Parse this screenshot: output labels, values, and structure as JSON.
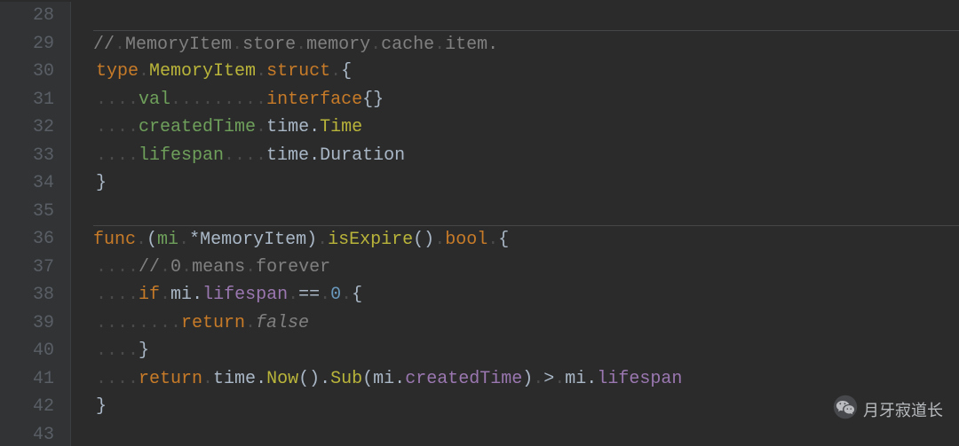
{
  "watermark": "月牙寂道长",
  "line_numbers": [
    "28",
    "29",
    "30",
    "31",
    "32",
    "33",
    "34",
    "35",
    "36",
    "37",
    "38",
    "39",
    "40",
    "41",
    "42",
    "43"
  ],
  "code": [
    {
      "n": 28,
      "sep": false,
      "tokens": []
    },
    {
      "n": 29,
      "sep": true,
      "tokens": [
        {
          "t": "//",
          "c": "comment"
        },
        {
          "t": ".",
          "c": "ws"
        },
        {
          "t": "MemoryItem",
          "c": "comment"
        },
        {
          "t": ".",
          "c": "ws"
        },
        {
          "t": "store",
          "c": "comment"
        },
        {
          "t": ".",
          "c": "ws"
        },
        {
          "t": "memory",
          "c": "comment"
        },
        {
          "t": ".",
          "c": "ws"
        },
        {
          "t": "cache",
          "c": "comment"
        },
        {
          "t": ".",
          "c": "ws"
        },
        {
          "t": "item.",
          "c": "comment"
        }
      ]
    },
    {
      "n": 30,
      "sep": false,
      "tokens": [
        {
          "t": "type",
          "c": "kw"
        },
        {
          "t": ".",
          "c": "ws"
        },
        {
          "t": "MemoryItem",
          "c": "typename"
        },
        {
          "t": ".",
          "c": "ws"
        },
        {
          "t": "struct",
          "c": "kw"
        },
        {
          "t": ".",
          "c": "ws"
        },
        {
          "t": "{",
          "c": "punc"
        }
      ]
    },
    {
      "n": 31,
      "sep": false,
      "tokens": [
        {
          "t": "....",
          "c": "ws"
        },
        {
          "t": "val",
          "c": "field"
        },
        {
          "t": ".........",
          "c": "ws"
        },
        {
          "t": "interface",
          "c": "kw"
        },
        {
          "t": "{}",
          "c": "punc"
        }
      ]
    },
    {
      "n": 32,
      "sep": false,
      "tokens": [
        {
          "t": "....",
          "c": "ws"
        },
        {
          "t": "createdTime",
          "c": "field"
        },
        {
          "t": ".",
          "c": "ws"
        },
        {
          "t": "time",
          "c": "pkg"
        },
        {
          "t": ".",
          "c": "punc"
        },
        {
          "t": "Time",
          "c": "typ"
        }
      ]
    },
    {
      "n": 33,
      "sep": false,
      "tokens": [
        {
          "t": "....",
          "c": "ws"
        },
        {
          "t": "lifespan",
          "c": "field"
        },
        {
          "t": "....",
          "c": "ws"
        },
        {
          "t": "time",
          "c": "pkg"
        },
        {
          "t": ".",
          "c": "punc"
        },
        {
          "t": "Duration",
          "c": "pkg"
        }
      ]
    },
    {
      "n": 34,
      "sep": false,
      "tokens": [
        {
          "t": "}",
          "c": "punc"
        }
      ]
    },
    {
      "n": 35,
      "sep": false,
      "tokens": []
    },
    {
      "n": 36,
      "sep": true,
      "tokens": [
        {
          "t": "func",
          "c": "kw"
        },
        {
          "t": ".",
          "c": "ws"
        },
        {
          "t": "(",
          "c": "punc"
        },
        {
          "t": "mi",
          "c": "field"
        },
        {
          "t": ".",
          "c": "ws"
        },
        {
          "t": "*",
          "c": "star"
        },
        {
          "t": "MemoryItem",
          "c": "pkg"
        },
        {
          "t": ")",
          "c": "punc"
        },
        {
          "t": ".",
          "c": "ws"
        },
        {
          "t": "isExpire",
          "c": "funcname"
        },
        {
          "t": "()",
          "c": "punc"
        },
        {
          "t": ".",
          "c": "ws"
        },
        {
          "t": "bool",
          "c": "kw2"
        },
        {
          "t": ".",
          "c": "ws"
        },
        {
          "t": "{",
          "c": "punc"
        }
      ]
    },
    {
      "n": 37,
      "sep": false,
      "tokens": [
        {
          "t": "....",
          "c": "ws"
        },
        {
          "t": "//",
          "c": "comment"
        },
        {
          "t": ".",
          "c": "ws"
        },
        {
          "t": "0",
          "c": "comment"
        },
        {
          "t": ".",
          "c": "ws"
        },
        {
          "t": "means",
          "c": "comment"
        },
        {
          "t": ".",
          "c": "ws"
        },
        {
          "t": "forever",
          "c": "comment"
        }
      ]
    },
    {
      "n": 38,
      "sep": false,
      "tokens": [
        {
          "t": "....",
          "c": "ws"
        },
        {
          "t": "if",
          "c": "kw"
        },
        {
          "t": ".",
          "c": "ws"
        },
        {
          "t": "mi",
          "c": "pkg"
        },
        {
          "t": ".",
          "c": "punc"
        },
        {
          "t": "lifespan",
          "c": "method"
        },
        {
          "t": ".",
          "c": "ws"
        },
        {
          "t": "==",
          "c": "punc"
        },
        {
          "t": ".",
          "c": "ws"
        },
        {
          "t": "0",
          "c": "num"
        },
        {
          "t": ".",
          "c": "ws"
        },
        {
          "t": "{",
          "c": "punc"
        }
      ]
    },
    {
      "n": 39,
      "sep": false,
      "tokens": [
        {
          "t": "........",
          "c": "ws"
        },
        {
          "t": "return",
          "c": "kw"
        },
        {
          "t": ".",
          "c": "ws"
        },
        {
          "t": "false",
          "c": "boolv"
        }
      ]
    },
    {
      "n": 40,
      "sep": false,
      "tokens": [
        {
          "t": "....",
          "c": "ws"
        },
        {
          "t": "}",
          "c": "punc"
        }
      ]
    },
    {
      "n": 41,
      "sep": false,
      "tokens": [
        {
          "t": "....",
          "c": "ws"
        },
        {
          "t": "return",
          "c": "kw"
        },
        {
          "t": ".",
          "c": "ws"
        },
        {
          "t": "time",
          "c": "pkg"
        },
        {
          "t": ".",
          "c": "punc"
        },
        {
          "t": "Now",
          "c": "funcname"
        },
        {
          "t": "()",
          "c": "punc"
        },
        {
          "t": ".",
          "c": "punc"
        },
        {
          "t": "Sub",
          "c": "funcname"
        },
        {
          "t": "(",
          "c": "punc"
        },
        {
          "t": "mi",
          "c": "pkg"
        },
        {
          "t": ".",
          "c": "punc"
        },
        {
          "t": "createdTime",
          "c": "method"
        },
        {
          "t": ")",
          "c": "punc"
        },
        {
          "t": ".",
          "c": "ws"
        },
        {
          "t": ">",
          "c": "punc"
        },
        {
          "t": ".",
          "c": "ws"
        },
        {
          "t": "mi",
          "c": "pkg"
        },
        {
          "t": ".",
          "c": "punc"
        },
        {
          "t": "lifespan",
          "c": "method"
        }
      ]
    },
    {
      "n": 42,
      "sep": false,
      "tokens": [
        {
          "t": "}",
          "c": "punc"
        }
      ]
    },
    {
      "n": 43,
      "sep": false,
      "tokens": []
    }
  ]
}
